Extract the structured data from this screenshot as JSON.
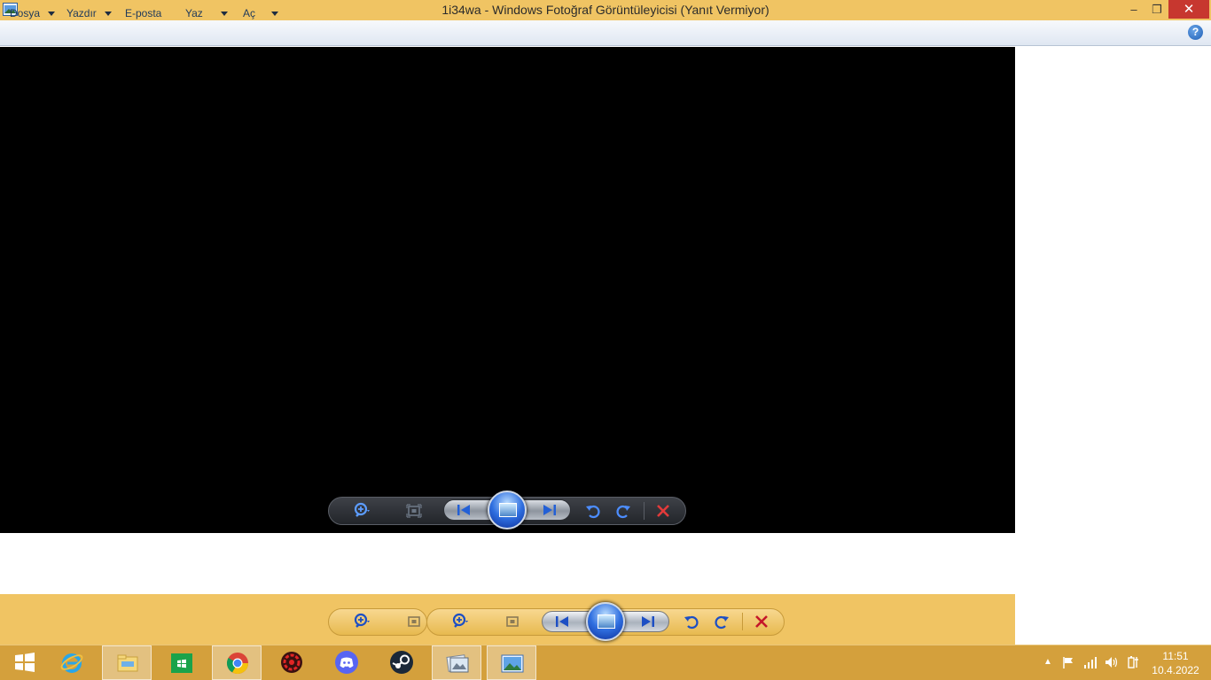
{
  "window": {
    "title": "1i34wa - Windows Fotoğraf Görüntüleyicisi (Yanıt Vermiyor)",
    "min_glyph": "–",
    "restore_glyph": "❐",
    "close_glyph": "✕"
  },
  "menu": {
    "items": [
      {
        "label": "Dosya"
      },
      {
        "label": "Yazdır"
      },
      {
        "label": "E-posta"
      },
      {
        "label": "Yaz"
      },
      {
        "label": "Aç"
      }
    ],
    "help_glyph": "?"
  },
  "controls": {
    "icons": [
      "zoom-icon",
      "actual-size-icon",
      "previous-icon",
      "slideshow-icon",
      "next-icon",
      "rotate-left-icon",
      "rotate-right-icon",
      "delete-icon"
    ]
  },
  "taskbar": {
    "apps": [
      {
        "name": "start"
      },
      {
        "name": "internet-explorer"
      },
      {
        "name": "file-explorer"
      },
      {
        "name": "store"
      },
      {
        "name": "chrome"
      },
      {
        "name": "app-red"
      },
      {
        "name": "discord"
      },
      {
        "name": "steam"
      },
      {
        "name": "photo-viewer-1"
      },
      {
        "name": "photo-viewer-2"
      }
    ],
    "clock": {
      "time": "11:51",
      "date": "10.4.2022"
    }
  },
  "colors": {
    "accent": "#f0c463",
    "taskbar": "#d4a03c",
    "close": "#c7372f"
  }
}
